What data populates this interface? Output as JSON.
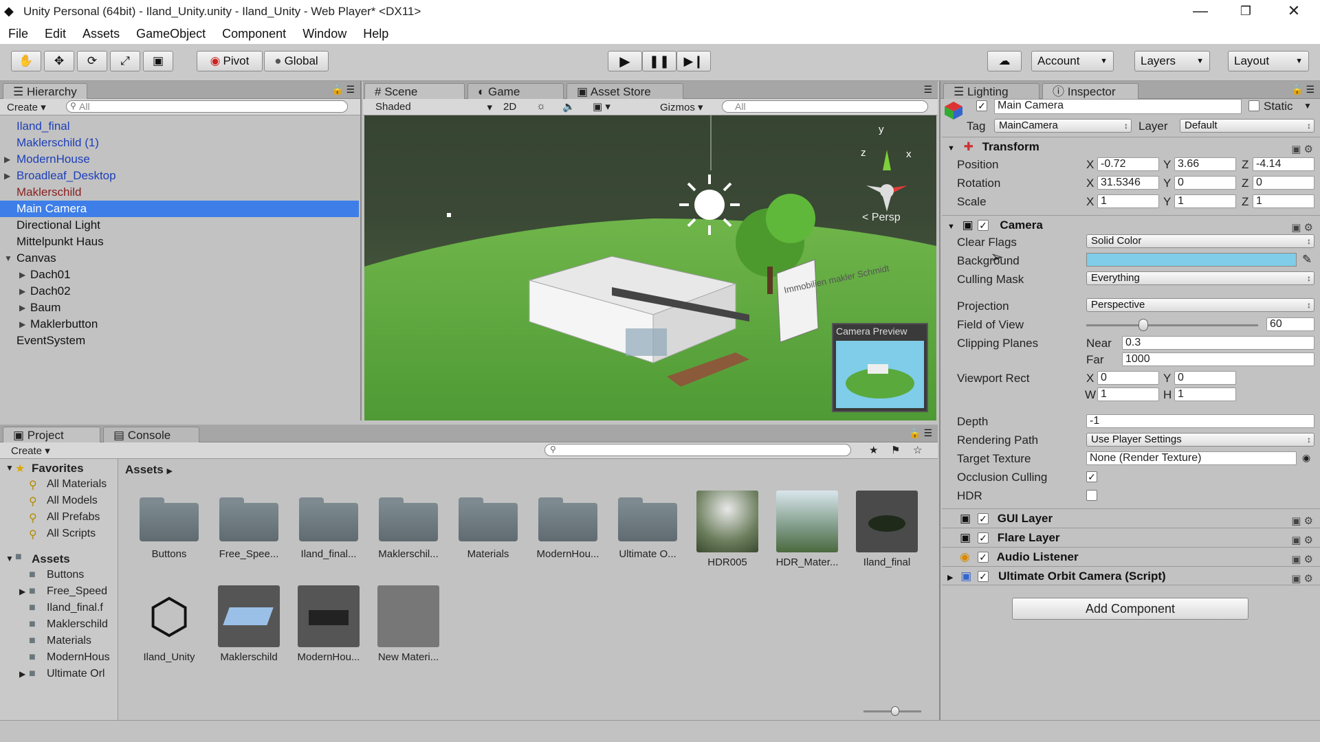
{
  "window": {
    "title": "Unity Personal (64bit) - Iland_Unity.unity - Iland_Unity - Web Player* <DX11>",
    "controls": {
      "minimize": "—",
      "restore": "❐",
      "close": "✕"
    }
  },
  "menu": [
    "File",
    "Edit",
    "Assets",
    "GameObject",
    "Component",
    "Window",
    "Help"
  ],
  "toolbar": {
    "pivot": "Pivot",
    "global": "Global",
    "account": "Account",
    "layers": "Layers",
    "layout": "Layout"
  },
  "hierarchy": {
    "tab": "Hierarchy",
    "create": "Create",
    "search_placeholder": "All",
    "items": [
      {
        "label": "Iland_final",
        "style": "blue"
      },
      {
        "label": "Maklerschild (1)",
        "style": "blue"
      },
      {
        "label": "ModernHouse",
        "style": "blue"
      },
      {
        "label": "Broadleaf_Desktop",
        "style": "blue"
      },
      {
        "label": "Maklerschild",
        "style": "red"
      },
      {
        "label": "Main Camera",
        "style": "selected"
      },
      {
        "label": "Directional Light",
        "style": "normal"
      },
      {
        "label": "Mittelpunkt Haus",
        "style": "normal"
      },
      {
        "label": "Canvas",
        "style": "normal"
      },
      {
        "label": "Dach01",
        "style": "normal"
      },
      {
        "label": "Dach02",
        "style": "normal"
      },
      {
        "label": "Baum",
        "style": "normal"
      },
      {
        "label": "Maklerbutton",
        "style": "normal"
      },
      {
        "label": "EventSystem",
        "style": "normal"
      }
    ]
  },
  "scene": {
    "tabs": [
      "Scene",
      "Game",
      "Asset Store"
    ],
    "shading": "Shaded",
    "mode_2d": "2D",
    "gizmos": "Gizmos",
    "search_placeholder": "All",
    "persp": "Persp",
    "gizmo_y": "y",
    "gizmo_z": "z",
    "gizmo_x": "x",
    "camera_preview": "Camera Preview",
    "sign_text": "Immobilien makler Schmidt"
  },
  "project": {
    "tabs": [
      "Project",
      "Console"
    ],
    "create": "Create",
    "favorites_label": "Favorites",
    "favorites": [
      "All Materials",
      "All Models",
      "All Prefabs",
      "All Scripts"
    ],
    "assets_label": "Assets",
    "tree": [
      "Buttons",
      "Free_Speed",
      "Iland_final.f",
      "Maklerschild",
      "Materials",
      "ModernHous",
      "Ultimate Orl"
    ],
    "breadcrumb": "Assets",
    "row1": [
      "Buttons",
      "Free_Spee...",
      "Iland_final...",
      "Maklerschil...",
      "Materials",
      "ModernHou...",
      "Ultimate O...",
      "HDR005",
      "HDR_Mater...",
      "Iland_final"
    ],
    "row2": [
      "Iland_Unity",
      "Maklerschild",
      "ModernHou...",
      "New Materi..."
    ]
  },
  "inspector": {
    "tabs": [
      "Lighting",
      "Inspector"
    ],
    "object_name": "Main Camera",
    "static_label": "Static",
    "tag_label": "Tag",
    "tag_value": "MainCamera",
    "layer_label": "Layer",
    "layer_value": "Default",
    "transform": {
      "title": "Transform",
      "position_label": "Position",
      "rotation_label": "Rotation",
      "scale_label": "Scale",
      "position": {
        "x": "-0.72",
        "y": "3.66",
        "z": "-4.14"
      },
      "rotation": {
        "x": "31.5346",
        "y": "0",
        "z": "0"
      },
      "scale": {
        "x": "1",
        "y": "1",
        "z": "1"
      }
    },
    "camera": {
      "title": "Camera",
      "clear_flags_label": "Clear Flags",
      "clear_flags": "Solid Color",
      "background_label": "Background",
      "background_color": "#7fcde8",
      "culling_mask_label": "Culling Mask",
      "culling_mask": "Everything",
      "projection_label": "Projection",
      "projection": "Perspective",
      "fov_label": "Field of View",
      "fov": "60",
      "fov_fraction": 0.33,
      "clipping_label": "Clipping Planes",
      "near_label": "Near",
      "near": "0.3",
      "far_label": "Far",
      "far": "1000",
      "viewport_label": "Viewport Rect",
      "vp_x": "0",
      "vp_y": "0",
      "vp_w": "1",
      "vp_h": "1",
      "depth_label": "Depth",
      "depth": "-1",
      "rendering_path_label": "Rendering Path",
      "rendering_path": "Use Player Settings",
      "target_texture_label": "Target Texture",
      "target_texture": "None (Render Texture)",
      "occlusion_label": "Occlusion Culling",
      "hdr_label": "HDR"
    },
    "components": [
      "GUI Layer",
      "Flare Layer",
      "Audio Listener",
      "Ultimate Orbit Camera (Script)"
    ],
    "add_component": "Add Component"
  }
}
